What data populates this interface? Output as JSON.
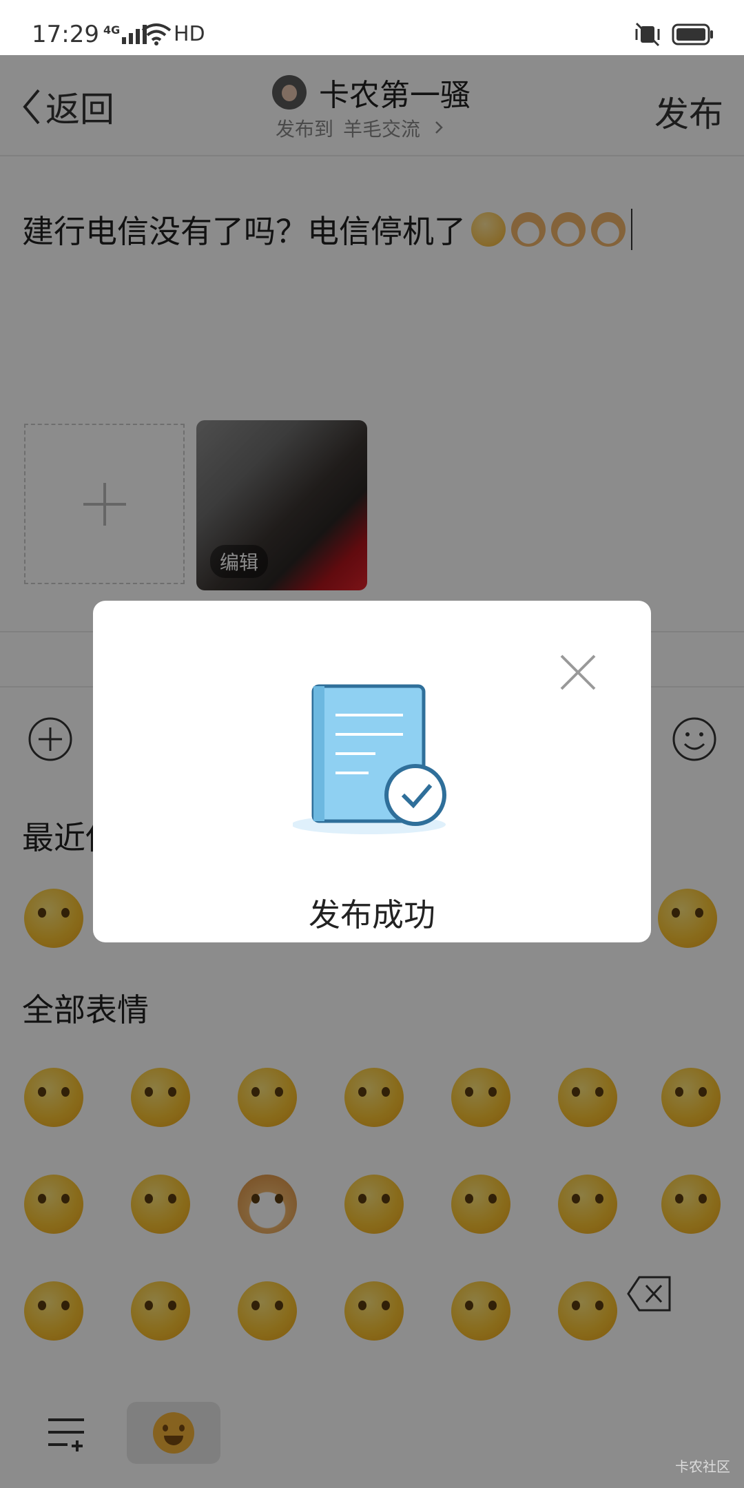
{
  "status_bar": {
    "time": "17:29",
    "network": "4G",
    "hd": "HD"
  },
  "header": {
    "back_label": "返回",
    "username": "卡农第一骚",
    "publish_to_label": "发布到",
    "board": "羊毛交流",
    "publish_label": "发布"
  },
  "post": {
    "text": "建行电信没有了吗？电信停机了",
    "image_edit_label": "编辑"
  },
  "emoji_panel": {
    "recent_title": "最近使",
    "all_title": "全部表情"
  },
  "modal": {
    "message": "发布成功"
  },
  "watermark": "卡农社区",
  "colors": {
    "modal_icon_blue": "#8fd0f2",
    "modal_icon_stroke": "#2f6f9a",
    "overlay": "#000000"
  }
}
